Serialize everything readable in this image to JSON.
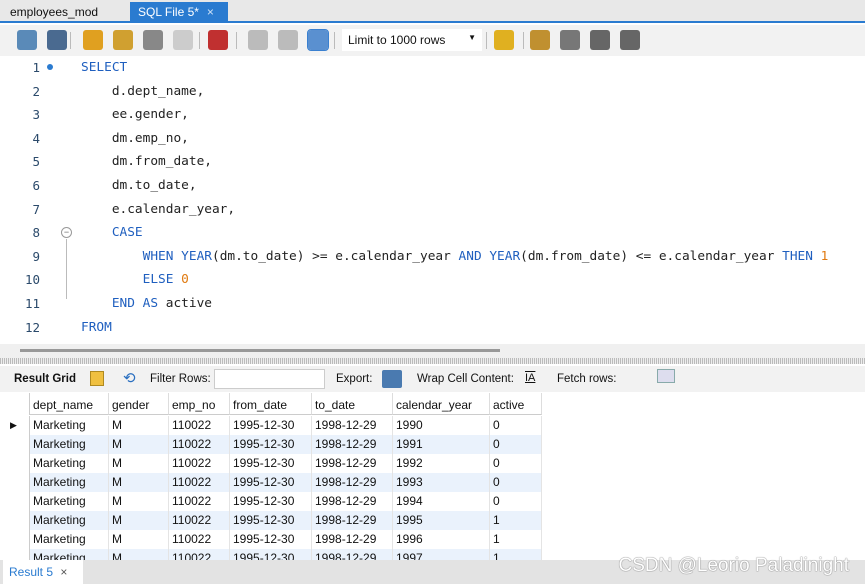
{
  "tabs": [
    {
      "label": "employees_mod",
      "active": false
    },
    {
      "label": "SQL File 5*",
      "active": true,
      "close": "×"
    }
  ],
  "toolbar": {
    "limit_select": "Limit to 1000 rows",
    "icons": [
      "open-folder-icon",
      "save-icon",
      "execute-icon",
      "execute-current-icon",
      "explain-icon",
      "stop-icon",
      "toggle-error-icon",
      "commit-icon",
      "rollback-icon",
      "autocommit-icon",
      "add-snippet-icon",
      "beautify-icon",
      "find-icon",
      "invisible-chars-icon",
      "wrap-icon"
    ]
  },
  "editor": {
    "line_numbers": [
      "1",
      "2",
      "3",
      "4",
      "5",
      "6",
      "7",
      "8",
      "9",
      "10",
      "11",
      "12"
    ],
    "lines": [
      [
        [
          "SELECT",
          "kw"
        ]
      ],
      [
        [
          "    d.dept_name,",
          ""
        ]
      ],
      [
        [
          "    ee.gender,",
          ""
        ]
      ],
      [
        [
          "    dm.emp_no,",
          ""
        ]
      ],
      [
        [
          "    dm.from_date,",
          ""
        ]
      ],
      [
        [
          "    dm.to_date,",
          ""
        ]
      ],
      [
        [
          "    e.calendar_year,",
          ""
        ]
      ],
      [
        [
          "    CASE",
          "kw"
        ]
      ],
      [
        [
          "        WHEN YEAR",
          "kw"
        ],
        [
          "(dm.to_date) >= e.calendar_year ",
          ""
        ],
        [
          "AND YEAR",
          "kw"
        ],
        [
          "(dm.from_date) <= e.calendar_year ",
          ""
        ],
        [
          "THEN ",
          "kw"
        ],
        [
          "1",
          "num"
        ]
      ],
      [
        [
          "        ELSE ",
          "kw"
        ],
        [
          "0",
          "num"
        ]
      ],
      [
        [
          "    END AS ",
          "kw"
        ],
        [
          "active",
          ""
        ]
      ],
      [
        [
          "FROM",
          "kw"
        ]
      ]
    ]
  },
  "result_toolbar": {
    "result_grid": "Result Grid",
    "filter_rows": "Filter Rows:",
    "filter_value": "",
    "export": "Export:",
    "wrap": "Wrap Cell Content:",
    "fetch": "Fetch rows:"
  },
  "grid": {
    "columns": [
      "dept_name",
      "gender",
      "emp_no",
      "from_date",
      "to_date",
      "calendar_year",
      "active"
    ],
    "rows": [
      [
        "Marketing",
        "M",
        "110022",
        "1995-12-30",
        "1998-12-29",
        "1990",
        "0"
      ],
      [
        "Marketing",
        "M",
        "110022",
        "1995-12-30",
        "1998-12-29",
        "1991",
        "0"
      ],
      [
        "Marketing",
        "M",
        "110022",
        "1995-12-30",
        "1998-12-29",
        "1992",
        "0"
      ],
      [
        "Marketing",
        "M",
        "110022",
        "1995-12-30",
        "1998-12-29",
        "1993",
        "0"
      ],
      [
        "Marketing",
        "M",
        "110022",
        "1995-12-30",
        "1998-12-29",
        "1994",
        "0"
      ],
      [
        "Marketing",
        "M",
        "110022",
        "1995-12-30",
        "1998-12-29",
        "1995",
        "1"
      ],
      [
        "Marketing",
        "M",
        "110022",
        "1995-12-30",
        "1998-12-29",
        "1996",
        "1"
      ],
      [
        "Marketing",
        "M",
        "110022",
        "1995-12-30",
        "1998-12-29",
        "1997",
        "1"
      ]
    ]
  },
  "bottom_tabs": [
    {
      "label": "Result 5",
      "close": "×"
    }
  ],
  "watermark": "CSDN @Leorio Paladinight"
}
